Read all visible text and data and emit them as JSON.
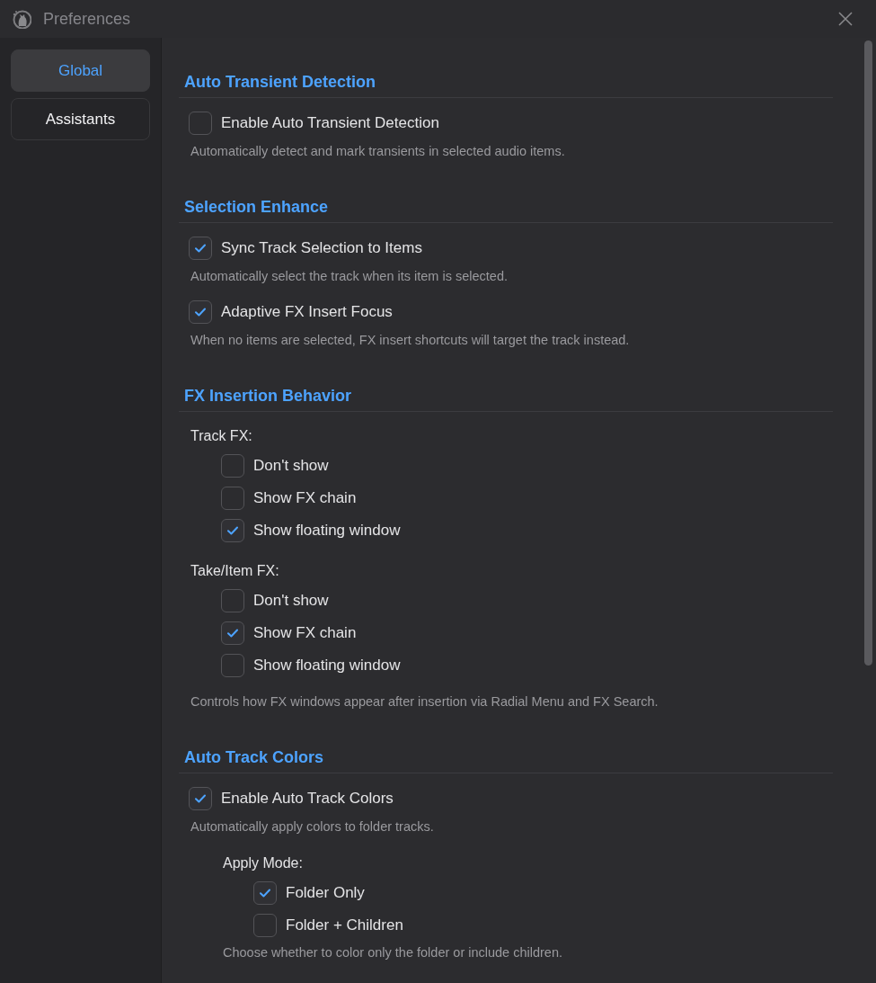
{
  "window": {
    "title": "Preferences"
  },
  "sidebar": {
    "items": [
      {
        "label": "Global",
        "selected": true
      },
      {
        "label": "Assistants",
        "selected": false
      }
    ]
  },
  "sections": [
    {
      "heading": "Auto Transient Detection",
      "items": [
        {
          "kind": "checkbox",
          "label": "Enable Auto Transient Detection",
          "checked": false,
          "description": "Automatically detect and mark transients in selected audio items."
        }
      ]
    },
    {
      "heading": "Selection Enhance",
      "items": [
        {
          "kind": "checkbox",
          "label": "Sync Track Selection to Items",
          "checked": true,
          "description": "Automatically select the track when its item is selected."
        },
        {
          "kind": "checkbox",
          "label": "Adaptive FX Insert Focus",
          "checked": true,
          "description": "When no items are selected, FX insert shortcuts will target the track instead."
        }
      ]
    },
    {
      "heading": "FX Insertion Behavior",
      "items": [
        {
          "kind": "group",
          "label": "Track FX:",
          "options": [
            {
              "label": "Don't show",
              "checked": false
            },
            {
              "label": "Show FX chain",
              "checked": false
            },
            {
              "label": "Show floating window",
              "checked": true
            }
          ]
        },
        {
          "kind": "group",
          "label": "Take/Item FX:",
          "options": [
            {
              "label": "Don't show",
              "checked": false
            },
            {
              "label": "Show FX chain",
              "checked": true
            },
            {
              "label": "Show floating window",
              "checked": false
            }
          ]
        },
        {
          "kind": "note",
          "text": "Controls how FX windows appear after insertion via Radial Menu and FX Search."
        }
      ]
    },
    {
      "heading": "Auto Track Colors",
      "items": [
        {
          "kind": "checkbox",
          "label": "Enable Auto Track Colors",
          "checked": true,
          "description": "Automatically apply colors to folder tracks.",
          "children": [
            {
              "kind": "group",
              "label": "Apply Mode:",
              "options": [
                {
                  "label": "Folder Only",
                  "checked": true
                },
                {
                  "label": "Folder + Children",
                  "checked": false
                }
              ]
            },
            {
              "kind": "note",
              "text": "Choose whether to color only the folder or include children."
            }
          ]
        }
      ]
    }
  ]
}
